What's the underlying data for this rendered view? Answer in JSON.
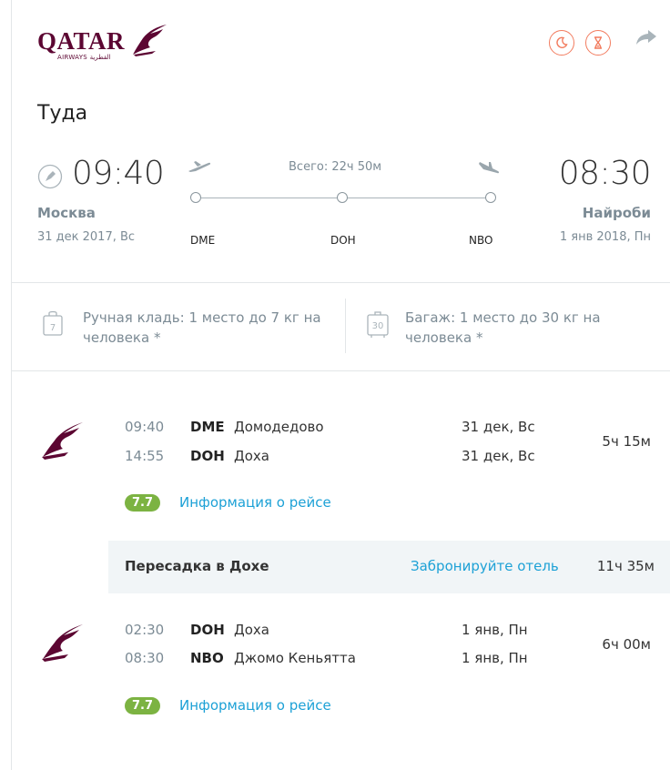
{
  "header": {
    "logo_text": "QATAR",
    "logo_sub": "AIRWAYS القطرية",
    "night_icon": "moon-icon",
    "long_layover_icon": "hourglass-icon",
    "share_icon": "share-arrow-icon",
    "accent": "#f27c5f",
    "brand": "#5c0632"
  },
  "direction_title": "Туда",
  "route": {
    "depart_time": "09:40",
    "arrive_time": "08:30",
    "depart_city": "Москва",
    "arrive_city": "Найроби",
    "depart_date": "31 дек 2017, Вс",
    "arrive_date": "1 янв 2018, Пн",
    "total": "Всего: 22ч 50м",
    "stops": [
      "DME",
      "DOH",
      "NBO"
    ]
  },
  "baggage": {
    "hand": "Ручная кладь: 1 место до 7 кг на человека *",
    "hand_weight": "7",
    "checked": "Багаж: 1 место до 30 кг на человека *",
    "checked_weight": "30"
  },
  "segments": [
    {
      "dep_time": "09:40",
      "dep_code": "DME",
      "dep_name": "Домодедово",
      "dep_date": "31 дек, Вс",
      "arr_time": "14:55",
      "arr_code": "DOH",
      "arr_name": "Доха",
      "arr_date": "31 дек, Вс",
      "duration": "5ч 15м",
      "rating": "7.7",
      "info_link": "Информация о рейсе"
    },
    {
      "dep_time": "02:30",
      "dep_code": "DOH",
      "dep_name": "Доха",
      "dep_date": "1 янв, Пн",
      "arr_time": "08:30",
      "arr_code": "NBO",
      "arr_name": "Джомо Кеньятта",
      "arr_date": "1 янв, Пн",
      "duration": "6ч 00м",
      "rating": "7.7",
      "info_link": "Информация о рейсе"
    }
  ],
  "layover": {
    "title": "Пересадка в Дохе",
    "hotel_link": "Забронируйте отель",
    "duration": "11ч 35м"
  }
}
